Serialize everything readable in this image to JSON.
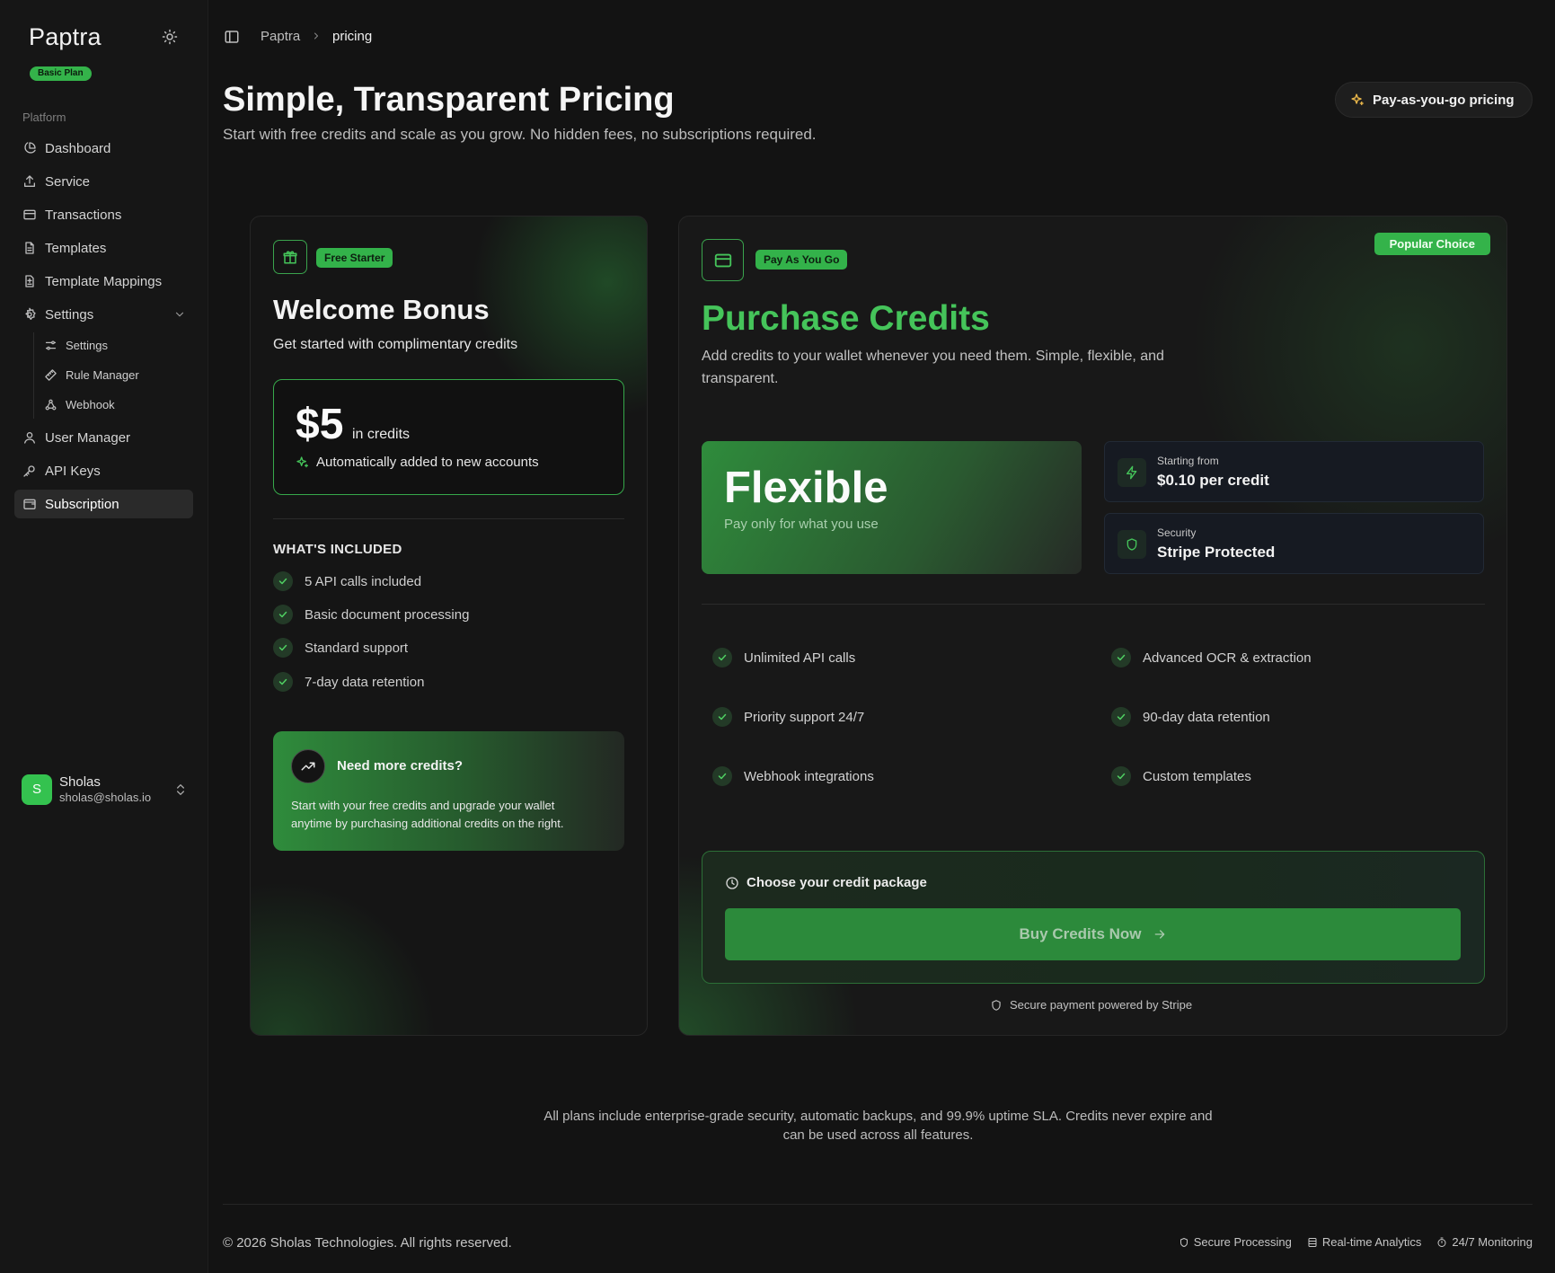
{
  "app": {
    "logo": "Paptra",
    "plan_badge": "Basic Plan"
  },
  "sidebar": {
    "group_label": "Platform",
    "items": [
      {
        "label": "Dashboard",
        "icon": "pie-chart-icon"
      },
      {
        "label": "Service",
        "icon": "upload-icon"
      },
      {
        "label": "Transactions",
        "icon": "credit-card-icon"
      },
      {
        "label": "Templates",
        "icon": "file-text-icon"
      },
      {
        "label": "Template Mappings",
        "icon": "file-diff-icon"
      },
      {
        "label": "Settings",
        "icon": "gear-icon"
      },
      {
        "label": "User Manager",
        "icon": "user-icon"
      },
      {
        "label": "API Keys",
        "icon": "key-icon"
      },
      {
        "label": "Subscription",
        "icon": "wallet-icon"
      }
    ],
    "settings_sub": [
      {
        "label": "Settings",
        "icon": "sliders-icon"
      },
      {
        "label": "Rule Manager",
        "icon": "ruler-icon"
      },
      {
        "label": "Webhook",
        "icon": "webhook-icon"
      }
    ],
    "user": {
      "initial": "S",
      "name": "Sholas",
      "email": "sholas@sholas.io"
    }
  },
  "breadcrumb": {
    "root": "Paptra",
    "current": "pricing"
  },
  "header": {
    "title": "Simple, Transparent Pricing",
    "subtitle": "Start with free credits and scale as you grow. No hidden fees, no subscriptions required.",
    "pill": "Pay-as-you-go pricing"
  },
  "free_card": {
    "tag": "Free Starter",
    "title": "Welcome Bonus",
    "subtitle": "Get started with complimentary credits",
    "amount": "$5",
    "amount_unit": "in credits",
    "amount_note": "Automatically added to new accounts",
    "included_heading": "WHAT'S INCLUDED",
    "features": [
      "5 API calls included",
      "Basic document processing",
      "Standard support",
      "7-day data retention"
    ],
    "more": {
      "title": "Need more credits?",
      "text": "Start with your free credits and upgrade your wallet anytime by purchasing additional credits on the right."
    }
  },
  "paid_card": {
    "tag": "Pay As You Go",
    "badge": "Popular Choice",
    "title": "Purchase Credits",
    "subtitle": "Add credits to your wallet whenever you need them. Simple, flexible, and transparent.",
    "flex_title": "Flexible",
    "flex_sub": "Pay only for what you use",
    "stats": [
      {
        "label": "Starting from",
        "value": "$0.10 per credit",
        "icon": "zap-icon"
      },
      {
        "label": "Security",
        "value": "Stripe Protected",
        "icon": "shield-icon"
      }
    ],
    "features_left": [
      "Unlimited API calls",
      "Priority support 24/7",
      "Webhook integrations"
    ],
    "features_right": [
      "Advanced OCR & extraction",
      "90-day data retention",
      "Custom templates"
    ],
    "package_heading": "Choose your credit package",
    "buy_label": "Buy Credits Now",
    "secure_note": "Secure payment powered by Stripe"
  },
  "fine_print": "All plans include enterprise-grade security, automatic backups, and 99.9% uptime SLA. Credits never expire and can be used across all features.",
  "footer": {
    "copyright": "© 2026 Sholas Technologies. All rights reserved.",
    "links": [
      "Secure Processing",
      "Real-time Analytics",
      "24/7 Monitoring"
    ]
  },
  "colors": {
    "accent": "#34b34a",
    "accent_text": "#45c45a",
    "background": "#131313"
  }
}
